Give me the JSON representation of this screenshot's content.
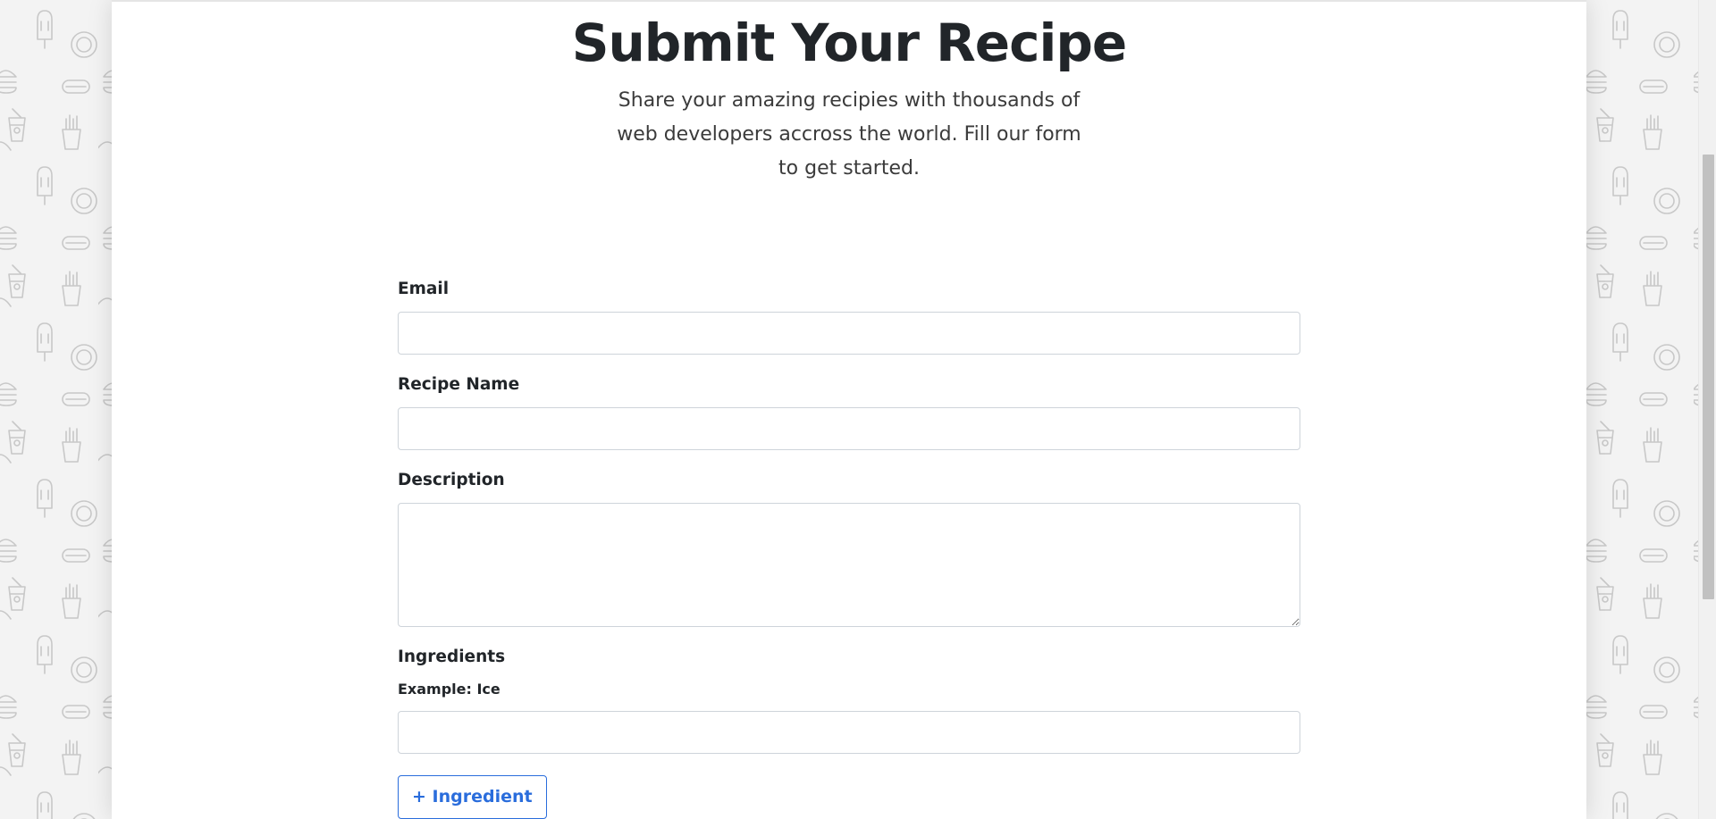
{
  "header": {
    "title": "Submit Your Recipe",
    "subtitle": "Share your amazing recipies with thousands of web developers accross the world. Fill our form to get started."
  },
  "form": {
    "email_label": "Email",
    "email_value": "",
    "recipe_name_label": "Recipe Name",
    "recipe_name_value": "",
    "description_label": "Description",
    "description_value": "",
    "ingredients_label": "Ingredients",
    "ingredient_example_label": "Example: Ice",
    "ingredient_value": "",
    "add_ingredient_button": "+ Ingredient"
  },
  "background": {
    "pattern_icons": [
      "popsicle-icon",
      "pizza-icon",
      "burger-icon",
      "hotdog-icon",
      "cup-icon",
      "fries-icon",
      "taco-icon"
    ]
  },
  "colors": {
    "accent": "#2a6ddc",
    "page_background": "#f3f3f3",
    "card_background": "#ffffff"
  }
}
